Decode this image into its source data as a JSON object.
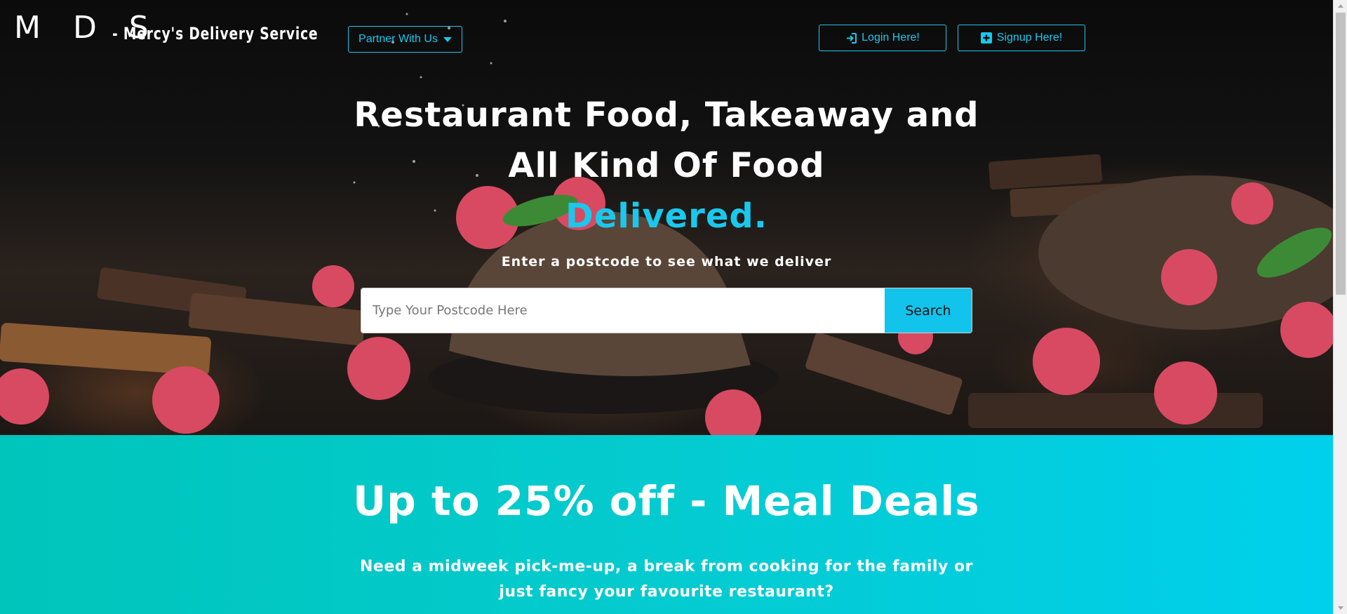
{
  "header": {
    "logo": "M D S",
    "brand": "- Mercy's Delivery Service",
    "partner_label": "Partner With Us",
    "login_label": "Login Here!",
    "signup_label": "Signup Here!"
  },
  "hero": {
    "headline": "Restaurant Food, Takeaway and All Kind Of Food",
    "highlight": "Delivered.",
    "subline": "Enter a postcode to see what we deliver",
    "search_placeholder": "Type Your Postcode Here",
    "search_value": "",
    "search_button": "Search"
  },
  "promo": {
    "title": "Up to 25% off - Meal Deals",
    "text": "Need a midweek pick-me-up, a break from cooking for the family or just fancy your favourite restaurant?"
  },
  "colors": {
    "accent": "#1ac8ed",
    "promo_start": "#00c5bb",
    "promo_end": "#00d0ec"
  },
  "icons": {
    "partner": "caret-down-icon",
    "login": "sign-in-icon",
    "signup": "plus-square-icon"
  }
}
